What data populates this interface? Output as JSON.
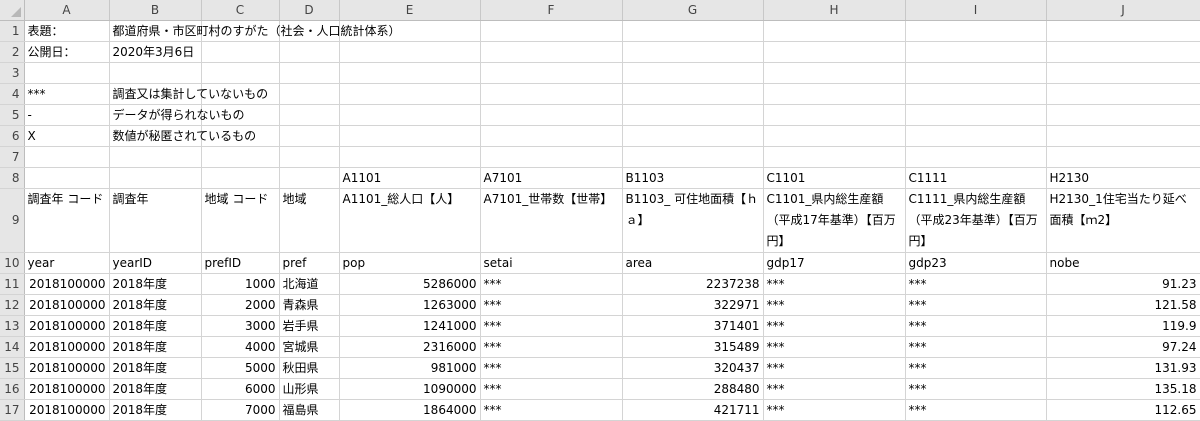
{
  "columns": [
    "A",
    "B",
    "C",
    "D",
    "E",
    "F",
    "G",
    "H",
    "I",
    "J"
  ],
  "rows": [
    {
      "n": "1",
      "cells": [
        "表題：",
        "都道府県・市区町村のすがた（社会・人口統計体系）",
        "",
        "",
        "",
        "",
        "",
        "",
        "",
        ""
      ]
    },
    {
      "n": "2",
      "cells": [
        "公開日：",
        "2020年3月6日",
        "",
        "",
        "",
        "",
        "",
        "",
        "",
        ""
      ]
    },
    {
      "n": "3",
      "cells": [
        "",
        "",
        "",
        "",
        "",
        "",
        "",
        "",
        "",
        ""
      ]
    },
    {
      "n": "4",
      "cells": [
        "***",
        "調査又は集計していないもの",
        "",
        "",
        "",
        "",
        "",
        "",
        "",
        ""
      ]
    },
    {
      "n": "5",
      "cells": [
        "-",
        "データが得られないもの",
        "",
        "",
        "",
        "",
        "",
        "",
        "",
        ""
      ]
    },
    {
      "n": "6",
      "cells": [
        "X",
        "数値が秘匿されているもの",
        "",
        "",
        "",
        "",
        "",
        "",
        "",
        ""
      ]
    },
    {
      "n": "7",
      "cells": [
        "",
        "",
        "",
        "",
        "",
        "",
        "",
        "",
        "",
        ""
      ]
    },
    {
      "n": "8",
      "cells": [
        "",
        "",
        "",
        "",
        "A1101",
        "A7101",
        "B1103",
        "C1101",
        "C1111",
        "H2130"
      ]
    },
    {
      "n": "9",
      "cells": [
        "調査年 コード",
        "調査年",
        "地域 コード",
        "地域",
        "A1101_総人口【人】",
        "A7101_世帯数【世帯】",
        "B1103_ 可住地面積【ｈａ】",
        "C1101_県内総生産額（平成17年基準）【百万円】",
        "C1111_県内総生産額（平成23年基準）【百万円】",
        "H2130_1住宅当たり延べ面積【ｍ2】"
      ]
    },
    {
      "n": "10",
      "cells": [
        "year",
        "yearID",
        "prefID",
        "pref",
        "pop",
        "setai",
        "area",
        "gdp17",
        "gdp23",
        "nobe"
      ]
    },
    {
      "n": "11",
      "cells": [
        "2018100000",
        "2018年度",
        "1000",
        "北海道",
        "5286000",
        "***",
        "2237238",
        "***",
        "***",
        "91.23"
      ]
    },
    {
      "n": "12",
      "cells": [
        "2018100000",
        "2018年度",
        "2000",
        "青森県",
        "1263000",
        "***",
        "322971",
        "***",
        "***",
        "121.58"
      ]
    },
    {
      "n": "13",
      "cells": [
        "2018100000",
        "2018年度",
        "3000",
        "岩手県",
        "1241000",
        "***",
        "371401",
        "***",
        "***",
        "119.9"
      ]
    },
    {
      "n": "14",
      "cells": [
        "2018100000",
        "2018年度",
        "4000",
        "宮城県",
        "2316000",
        "***",
        "315489",
        "***",
        "***",
        "97.24"
      ]
    },
    {
      "n": "15",
      "cells": [
        "2018100000",
        "2018年度",
        "5000",
        "秋田県",
        "981000",
        "***",
        "320437",
        "***",
        "***",
        "131.93"
      ]
    },
    {
      "n": "16",
      "cells": [
        "2018100000",
        "2018年度",
        "6000",
        "山形県",
        "1090000",
        "***",
        "288480",
        "***",
        "***",
        "135.18"
      ]
    },
    {
      "n": "17",
      "cells": [
        "2018100000",
        "2018年度",
        "7000",
        "福島県",
        "1864000",
        "***",
        "421711",
        "***",
        "***",
        "112.65"
      ]
    }
  ]
}
